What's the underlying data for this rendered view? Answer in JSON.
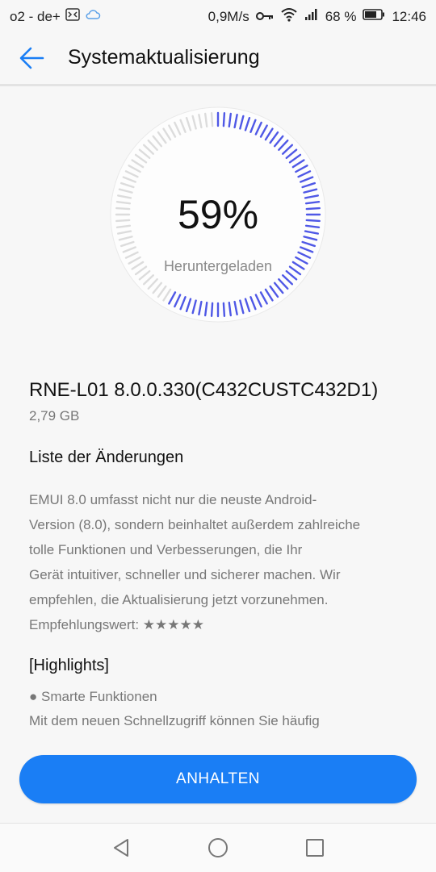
{
  "status_bar": {
    "carrier": "o2 - de+",
    "net_speed": "0,9M/s",
    "battery": "68 %",
    "time": "12:46",
    "icons": [
      "cat-notification-icon",
      "cloud-icon",
      "key-icon",
      "wifi-icon",
      "signal-icon",
      "battery-icon"
    ]
  },
  "header": {
    "title": "Systemaktualisierung",
    "back_icon": "arrow-left-icon"
  },
  "download": {
    "percent": 59,
    "percent_text": "59%",
    "status_label": "Heruntergeladen",
    "ring_active_color": "#4f58e6",
    "ring_inactive_color": "#dcdcdc"
  },
  "update": {
    "version": "RNE-L01 8.0.0.330(C432CUSTC432D1)",
    "size": "2,79 GB"
  },
  "changelog": {
    "title": "Liste der Änderungen",
    "lines": [
      "EMUI 8.0 umfasst nicht nur die neuste Android-",
      "Version (8.0), sondern beinhaltet außerdem zahlreiche",
      "tolle Funktionen und Verbesserungen, die Ihr",
      "Gerät intuitiver, schneller und sicherer machen. Wir",
      "empfehlen, die Aktualisierung jetzt vorzunehmen.",
      "Empfehlungswert: ★★★★★"
    ],
    "highlights_heading": "[Highlights]",
    "bullet": "● Smarte Funktionen",
    "bullet_desc": "Mit dem neuen Schnellzugriff können Sie häufig"
  },
  "actions": {
    "pause_label": "ANHALTEN",
    "accent": "#1a7ef5"
  },
  "nav_bar": {
    "icons": [
      "back-triangle-icon",
      "home-circle-icon",
      "recents-square-icon"
    ]
  }
}
